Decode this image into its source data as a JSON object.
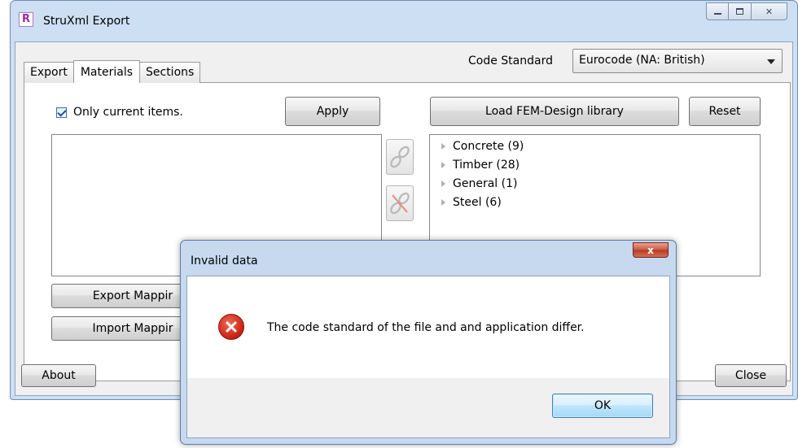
{
  "window": {
    "title": "StruXml Export",
    "app_icon_letter": "R",
    "controls": {
      "minimize": "—",
      "maximize": "▫",
      "close": "✕"
    }
  },
  "tabs": [
    {
      "label": "Export",
      "active": false
    },
    {
      "label": "Materials",
      "active": true
    },
    {
      "label": "Sections",
      "active": false
    }
  ],
  "code_standard": {
    "label": "Code Standard",
    "selected": "Eurocode (NA: British)"
  },
  "left_panel": {
    "only_current_label": "Only current items.",
    "only_current_checked": true,
    "apply_label": "Apply",
    "export_mapping_label": "Export Mappir",
    "import_mapping_label": "Import Mappir"
  },
  "right_panel": {
    "load_library_label": "Load FEM-Design library",
    "reset_label": "Reset",
    "tree": [
      {
        "label": "Concrete",
        "count": "(9)"
      },
      {
        "label": "Timber",
        "count": "(28)"
      },
      {
        "label": "General",
        "count": "(1)"
      },
      {
        "label": "Steel",
        "count": "(6)"
      }
    ]
  },
  "footer": {
    "about_label": "About",
    "close_label": "Close"
  },
  "dialog": {
    "title": "Invalid data",
    "message": "The code standard of the file and and application differ.",
    "ok_label": "OK",
    "icon": "error-icon",
    "close_glyph": "x"
  },
  "colors": {
    "window_frame": "#cddff3",
    "error_red": "#c8200f",
    "ok_focus_border": "#3c7fb1"
  }
}
